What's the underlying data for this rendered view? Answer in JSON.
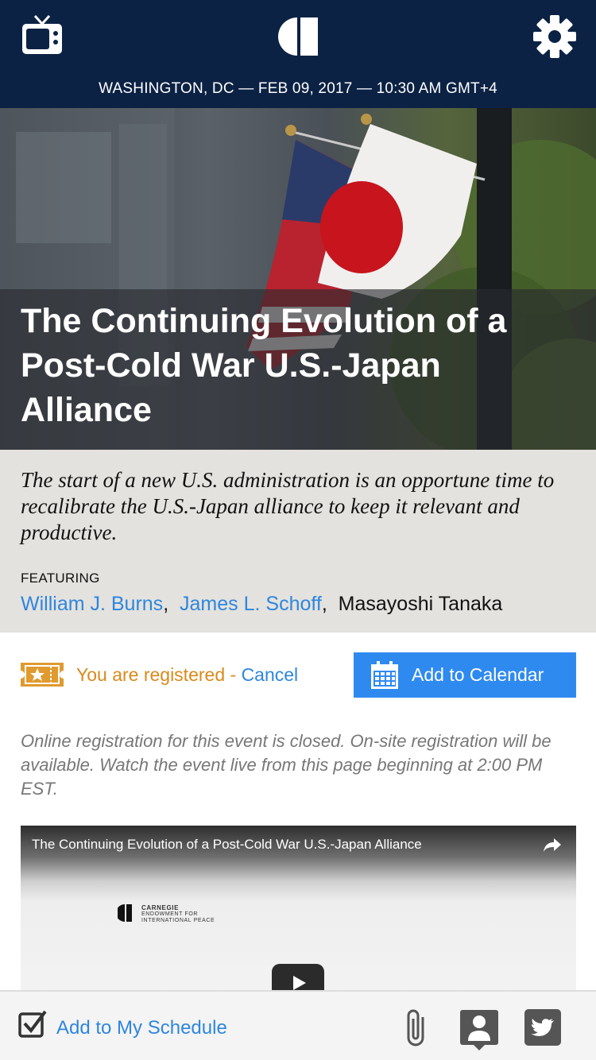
{
  "header": {
    "dateline": "WASHINGTON, DC — FEB 09, 2017 — 10:30 AM GMT+4",
    "bg_color": "#0c2244",
    "icons": [
      "tv-icon",
      "carnegie-logo",
      "gear-icon"
    ]
  },
  "hero": {
    "title": "The Continuing Evolution of a Post-Cold War U.S.-Japan Alliance"
  },
  "summary": {
    "text": "The start of a new U.S. administration is an opportune time to recalibrate the U.S.-Japan alliance to keep it relevant and productive.",
    "featuring_label": "FEATURING",
    "speakers": [
      {
        "name": "William J. Burns",
        "link": true
      },
      {
        "name": "James L. Schoff",
        "link": true
      },
      {
        "name": "Masayoshi Tanaka",
        "link": false
      }
    ]
  },
  "registration": {
    "status": "You are registered -",
    "cancel": "Cancel",
    "calendar_button": "Add to Calendar",
    "status_color": "#d98a1a",
    "accent_color": "#2f8af0",
    "note": "Online registration for this event is closed. On-site registration will be available. Watch the event live from this page beginning at 2:00 PM EST."
  },
  "video": {
    "title": "The Continuing Evolution of a Post-Cold War U.S.-Japan Alliance",
    "org_name": "CARNEGIE",
    "org_line2": "ENDOWMENT FOR",
    "org_line3": "INTERNATIONAL PEACE"
  },
  "bottom_bar": {
    "schedule_label": "Add to My Schedule",
    "icons": [
      "checkbox-icon",
      "attachment-icon",
      "speaker-profile-icon",
      "twitter-icon"
    ]
  }
}
